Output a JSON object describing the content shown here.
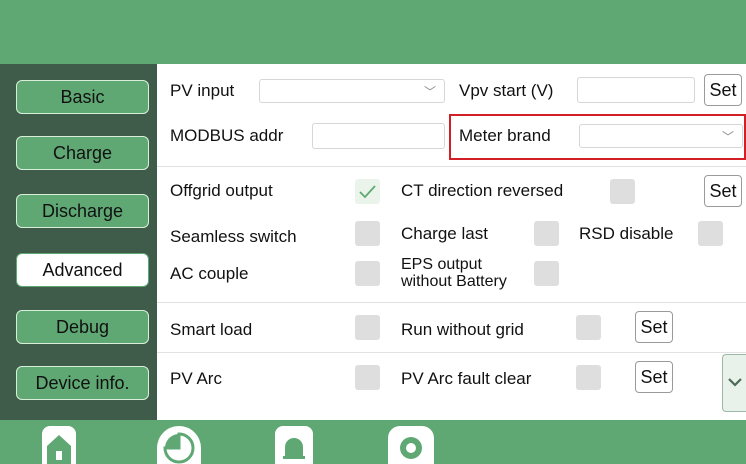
{
  "sidebar": {
    "items": [
      {
        "label": "Basic"
      },
      {
        "label": "Charge"
      },
      {
        "label": "Discharge"
      },
      {
        "label": "Advanced"
      },
      {
        "label": "Debug"
      },
      {
        "label": "Device info."
      }
    ],
    "active": "Advanced"
  },
  "settings": {
    "pv_input": {
      "label": "PV input",
      "value": ""
    },
    "vpv_start": {
      "label": "Vpv start (V)",
      "value": "",
      "button": "Set"
    },
    "modbus_addr": {
      "label": "MODBUS addr",
      "value": ""
    },
    "meter_brand": {
      "label": "Meter brand",
      "value": ""
    },
    "offgrid_output": {
      "label": "Offgrid output",
      "checked": true
    },
    "ct_direction": {
      "label": "CT direction reversed",
      "checked": false,
      "button": "Set"
    },
    "seamless_switch": {
      "label": "Seamless switch",
      "checked": false
    },
    "charge_last": {
      "label": "Charge last",
      "checked": false
    },
    "rsd_disable": {
      "label": "RSD disable",
      "checked": false
    },
    "ac_couple": {
      "label": "AC couple",
      "checked": false
    },
    "eps_output": {
      "label_line1": "EPS output",
      "label_line2": "without Battery",
      "checked": false
    },
    "smart_load": {
      "label": "Smart load",
      "checked": false
    },
    "run_without_grid": {
      "label": "Run without grid",
      "checked": false,
      "button": "Set"
    },
    "pv_arc": {
      "label": "PV Arc",
      "checked": false
    },
    "pv_arc_fault_clear": {
      "label": "PV Arc fault clear",
      "checked": false,
      "button": "Set"
    }
  },
  "bottom_nav": [
    "home-icon",
    "pie-chart-icon",
    "bell-icon",
    "gear-icon"
  ],
  "colors": {
    "accent": "#5fa874",
    "sidebar": "#3e5c49",
    "highlight": "#d21f25"
  }
}
